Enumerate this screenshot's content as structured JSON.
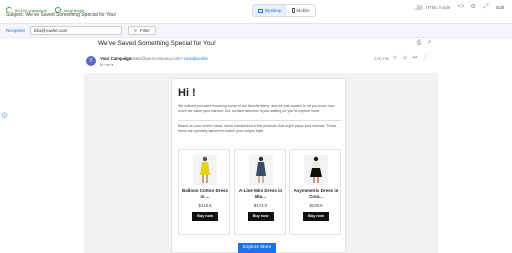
{
  "metrics": [
    {
      "label": "82/100 characters",
      "icon": "progress-ring-icon"
    },
    {
      "label": "Ideal length",
      "icon": "check-ring-icon"
    }
  ],
  "subject": "Subject:  We've Saved Something Special for You!",
  "view_toggle": {
    "desktop": "Desktop",
    "mobile": "Mobile",
    "active": "desktop"
  },
  "toolbar": {
    "html_mode": "HTML mode",
    "edit": "Edit"
  },
  "recipient": {
    "label": "Recipient",
    "value": "bilu@rowlet.com",
    "filter": "Filter"
  },
  "email": {
    "subject": "We've Saved Something Special for You!",
    "avatar_letter": "Y",
    "sender_name": "Your Campaign",
    "sender_email": "<contact@yourcompany.com>",
    "unsubscribe": "Unsubscribe",
    "to": "to me ▾",
    "time": "2:00 PM",
    "greeting": "Hi !",
    "intro": "We noticed you were browsing some of our favorite items, and we just wanted to let you know how much we value your interest. Our curated selection is just waiting for you to explore more.",
    "intro2": "Based on your recent views, we've handpicked a few products that might pique your interest. These items are specially tailored to match your unique style.",
    "products": [
      {
        "name": "Balloon Cotton Dress in ...",
        "price": "$418.5",
        "button": "Buy now",
        "color": "#e6d21e"
      },
      {
        "name": "A-Line Mini Dress in Blu...",
        "price": "$174.0",
        "button": "Buy now",
        "color": "#3a4a64"
      },
      {
        "name": "Asymmetric Dress in Crea...",
        "price": "$229.0",
        "button": "Buy now",
        "color": "#ede6d9"
      }
    ],
    "explore": "Explore More"
  },
  "colors": {
    "accent": "#1a73e8",
    "success": "#43a047",
    "dark_button": "#111111"
  }
}
